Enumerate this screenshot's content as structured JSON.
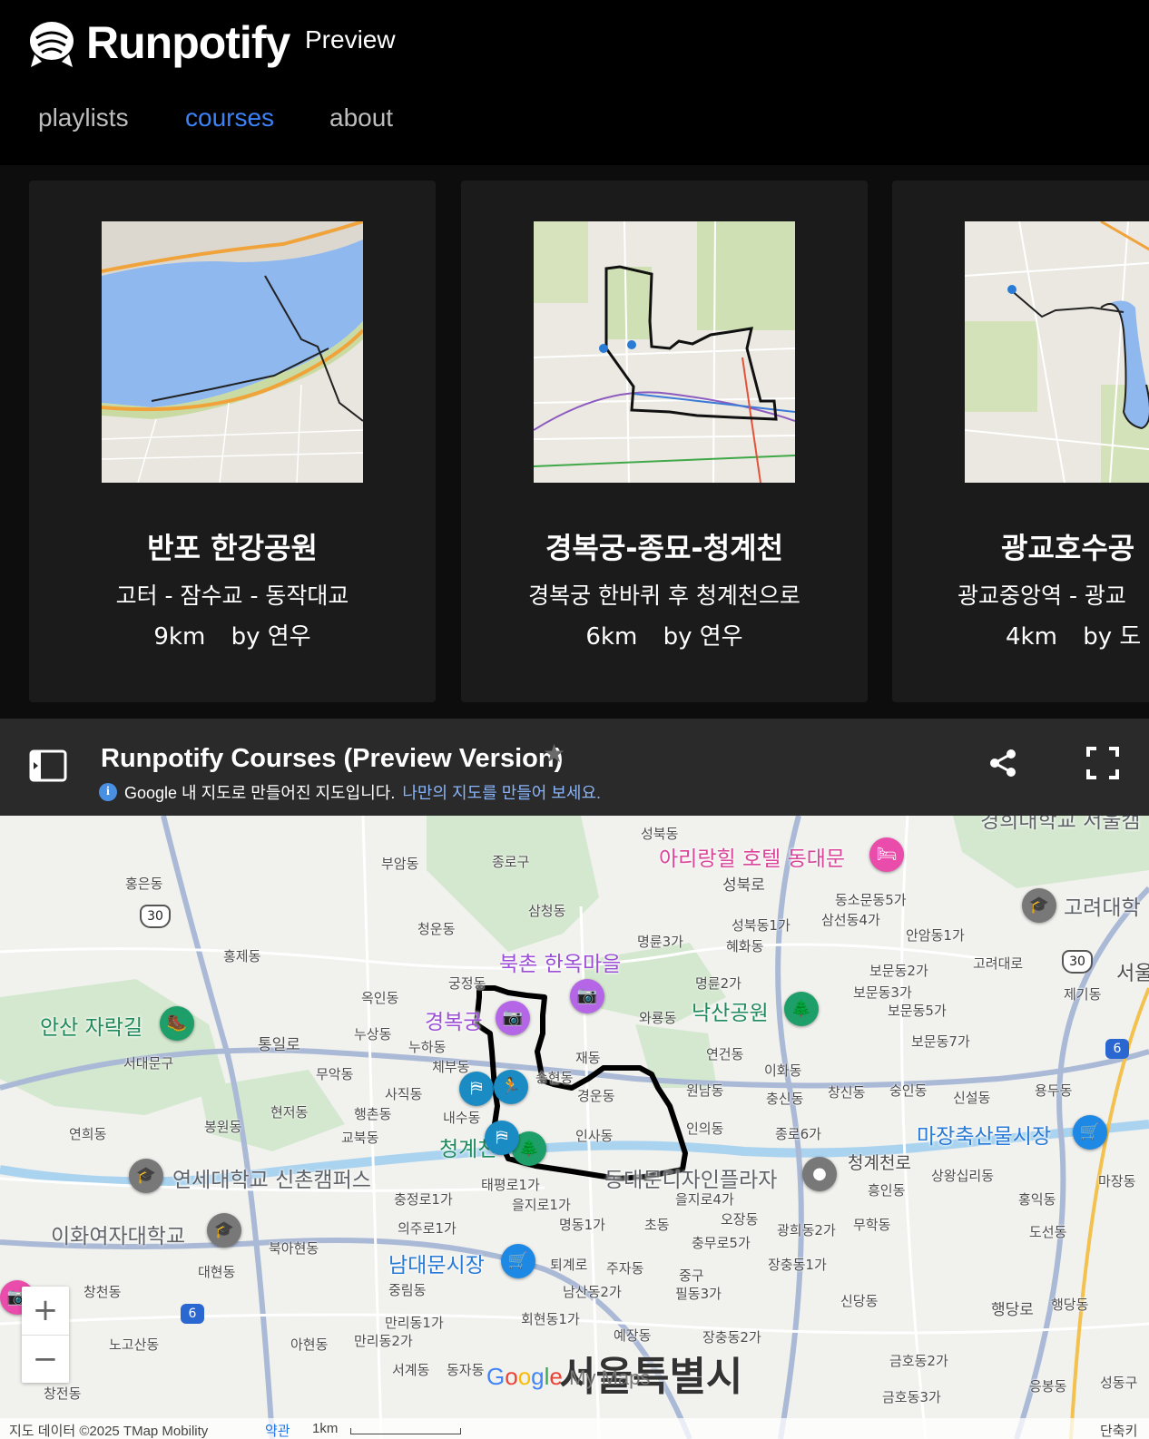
{
  "header": {
    "brand": "Runpotify",
    "badge": "Preview",
    "nav": [
      {
        "label": "playlists",
        "active": false
      },
      {
        "label": "courses",
        "active": true
      },
      {
        "label": "about",
        "active": false
      }
    ]
  },
  "courses": [
    {
      "title": "반포 한강공원",
      "route": "고터 - 잠수교 - 동작대교",
      "distance": "9km",
      "author": "by 연우"
    },
    {
      "title": "경복궁-종묘-청계천",
      "route": "경복궁 한바퀴 후 청계천으로",
      "distance": "6km",
      "author": "by 연우"
    },
    {
      "title": "광교호수공",
      "route": "광교중앙역 - 광교",
      "distance": "4km",
      "author": "by 도"
    }
  ],
  "mymaps": {
    "title": "Runpotify Courses (Preview Version)",
    "info_text": "Google 내 지도로 만들어진 지도입니다.",
    "info_link": "나만의 지도를 만들어 보세요."
  },
  "map": {
    "pois": [
      {
        "name": "아리랑힐 호텔 동대문",
        "color": "pink",
        "icon": "hotel-icon"
      },
      {
        "name": "북촌 한옥마을",
        "color": "purple",
        "icon": "camera-icon"
      },
      {
        "name": "경복궁",
        "color": "purple",
        "icon": "camera-icon"
      },
      {
        "name": "낙산공원",
        "color": "green",
        "icon": "tree-icon"
      },
      {
        "name": "고려대학",
        "color": "grey",
        "icon": "school-icon"
      },
      {
        "name": "안산 자락길",
        "color": "green",
        "icon": "hiking-icon"
      },
      {
        "name": "마장축산물시장",
        "color": "blue",
        "icon": "cart-icon"
      },
      {
        "name": "연세대학교 신촌캠퍼스",
        "color": "grey",
        "icon": "school-icon"
      },
      {
        "name": "이화여자대학교",
        "color": "grey",
        "icon": "school-icon"
      },
      {
        "name": "남대문시장",
        "color": "blue",
        "icon": "cart-icon"
      },
      {
        "name": "동대문디자인플라자",
        "color": "grey",
        "icon": "place-icon"
      },
      {
        "name": "청계천",
        "color": "green",
        "icon": "tree-icon"
      },
      {
        "name": "경희대학교 서울캠",
        "color": "grey",
        "icon": "school-icon"
      }
    ],
    "labels": [
      "성북동",
      "부암동",
      "종로구",
      "홍은동",
      "삼청동",
      "청운동",
      "명륜3가",
      "성북동1가",
      "혜화동",
      "동소문동5가",
      "삼선동4가",
      "안암동1가",
      "고려대로",
      "홍제동",
      "궁정동",
      "명륜2가",
      "보문동2가",
      "보문동3가",
      "보문동5가",
      "제기동",
      "옥인동",
      "와룡동",
      "누상동",
      "누하동",
      "체부동",
      "재동",
      "연건동",
      "이화동",
      "보문동7가",
      "서대문구",
      "무악동",
      "사직동",
      "내수동",
      "송현동",
      "경운동",
      "원남동",
      "충신동",
      "창신동",
      "숭인동",
      "신설동",
      "용두동",
      "현저동",
      "행촌동",
      "봉원동",
      "교북동",
      "인의동",
      "종로6가",
      "인사동",
      "연희동",
      "태평로1가",
      "을지로1가",
      "을지로4가",
      "충정로1가",
      "흥인동",
      "상왕십리동",
      "홍익동",
      "마장동",
      "도선동",
      "명동1가",
      "초동",
      "오장동",
      "의주로1가",
      "북아현동",
      "무학동",
      "광희동2가",
      "충무로5가",
      "대현동",
      "퇴계로",
      "주자동",
      "중구",
      "장충동1가",
      "창천동",
      "중림동",
      "남산동2가",
      "필동3가",
      "신당동",
      "행당동",
      "회현동1가",
      "만리동1가",
      "노고산동",
      "아현동",
      "만리동2가",
      "예장동",
      "장충동2가",
      "금호동2가",
      "서계동",
      "동자동",
      "응봉동",
      "성동구",
      "창전동",
      "금호동3가",
      "청계천로",
      "행당로",
      "성북로",
      "통일로",
      "서울특별시",
      "서울"
    ],
    "big_label": "서울특별시",
    "shields": [
      "30",
      "30",
      "6",
      "6"
    ],
    "zoom_in": "+",
    "zoom_out": "−",
    "footer": {
      "data": "지도 데이터 ©2025 TMap Mobility",
      "terms": "약관",
      "scale": "1km",
      "shortcut": "단축키"
    },
    "logo": "Google My Maps"
  }
}
